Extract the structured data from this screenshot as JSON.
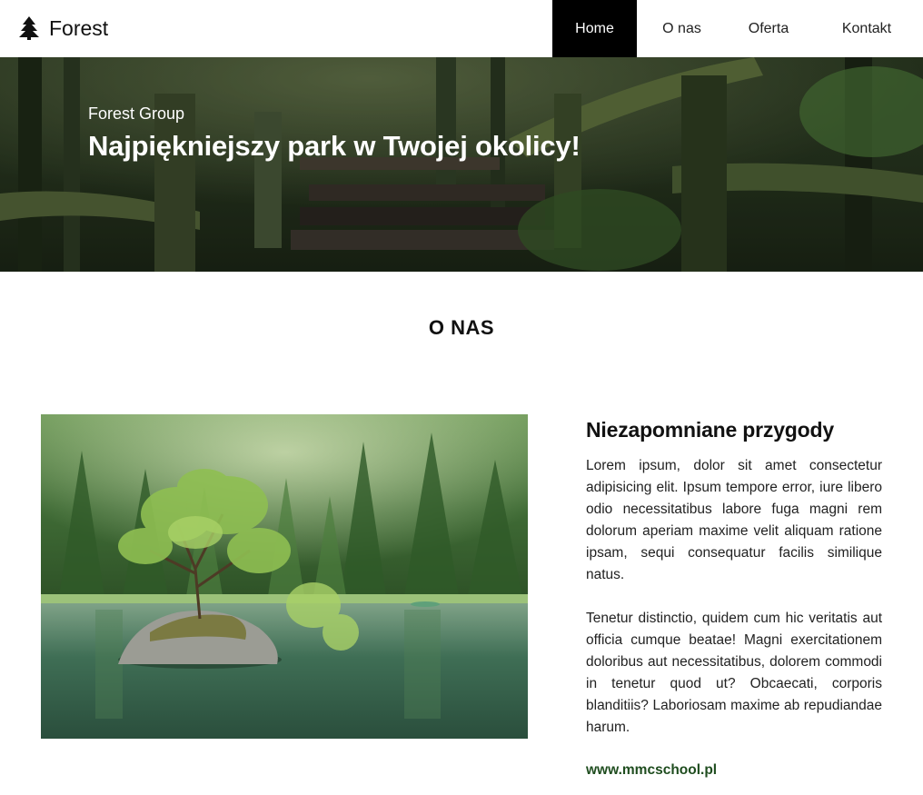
{
  "nav": {
    "brand": "Forest",
    "brand_icon": "pine-tree-icon",
    "items": [
      {
        "label": "Home",
        "active": true
      },
      {
        "label": "O nas",
        "active": false
      },
      {
        "label": "Oferta",
        "active": false
      },
      {
        "label": "Kontakt",
        "active": false
      }
    ]
  },
  "hero": {
    "subtitle": "Forest Group",
    "title": "Najpiękniejszy park w Twojej okolicy!"
  },
  "about": {
    "section_title": "O NAS",
    "heading": "Niezapomniane przygody",
    "paragraphs": [
      "Lorem ipsum, dolor sit amet consectetur adipisicing elit. Ipsum tempore error, iure libero odio necessitatibus labore fuga magni rem dolorum aperiam maxime velit aliquam ratione ipsam, sequi consequatur facilis similique natus.",
      "Tenetur distinctio, quidem cum hic veritatis aut officia cumque beatae! Magni exercitationem doloribus aut necessitatibus, dolorem commodi in tenetur quod ut? Obcaecati, corporis blanditiis? Laboriosam maxime ab repudiandae harum."
    ],
    "link": "www.mmcschool.pl"
  },
  "colors": {
    "active_nav_bg": "#000000",
    "link_green": "#1f4d1f"
  }
}
